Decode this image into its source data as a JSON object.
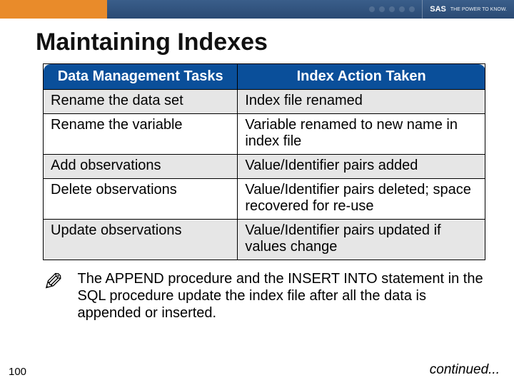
{
  "brand": {
    "name": "SAS",
    "tagline": "THE POWER TO KNOW."
  },
  "slide": {
    "title": "Maintaining Indexes",
    "page_number": "100",
    "continued_label": "continued..."
  },
  "table": {
    "headers": {
      "col1": "Data Management Tasks",
      "col2": "Index Action Taken"
    },
    "rows": [
      {
        "task": "Rename the data set",
        "action": "Index file renamed"
      },
      {
        "task": "Rename the variable",
        "action": "Variable renamed to new name in index file"
      },
      {
        "task": "Add observations",
        "action": "Value/Identifier pairs added"
      },
      {
        "task": "Delete observations",
        "action": "Value/Identifier pairs deleted; space recovered for re-use"
      },
      {
        "task": "Update observations",
        "action": "Value/Identifier pairs updated if values change"
      }
    ]
  },
  "note": {
    "icon": "pencil-icon",
    "text": "The APPEND procedure and the INSERT INTO statement in the SQL procedure update the index file after all the data is appended or inserted."
  }
}
